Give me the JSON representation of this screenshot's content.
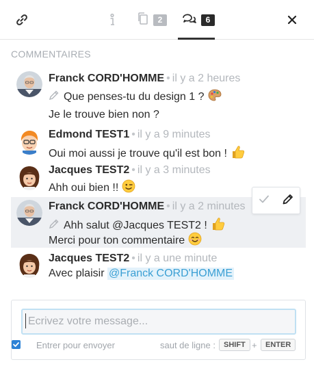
{
  "toolbar": {
    "files_count": "2",
    "comments_count": "6",
    "active_tab": "comments"
  },
  "section_title": "COMMENTAIRES",
  "comments": [
    {
      "author": "Franck CORD'HOMME",
      "time": "il y a 2 heures",
      "lines": [
        "Que penses-tu du design 1 ?",
        "Je le trouve bien non ?"
      ],
      "edited": true,
      "avatar": "franck-avatar",
      "emoji": "palette-icon"
    },
    {
      "author": "Edmond TEST1",
      "time": "il y a 9 minutes",
      "lines": [
        "Oui moi aussi je trouve qu'il est bon !"
      ],
      "avatar": "edmond-avatar",
      "emoji": "thumbs-up-icon"
    },
    {
      "author": "Jacques TEST2",
      "time": "il y a 3 minutes",
      "lines": [
        "Ahh oui bien !!"
      ],
      "avatar": "jacques-avatar",
      "emoji": "winking-face-icon"
    },
    {
      "author": "Franck CORD'HOMME",
      "time": "il y a 2 minutes",
      "lines": [
        "Ahh salut @Jacques TEST2 !",
        "Merci pour ton commentaire"
      ],
      "edited": true,
      "highlighted": true,
      "avatar": "franck-avatar",
      "emoji": [
        "thumbs-up-icon",
        "smiling-face-icon"
      ]
    },
    {
      "author": "Jacques TEST2",
      "time": "il y a une minute",
      "text": "Avec plaisir",
      "mention": "@Franck CORD'HOMME",
      "avatar": "jacques-avatar"
    }
  ],
  "composer": {
    "placeholder": "Ecrivez votre message...",
    "send_on_enter_label": "Entrer pour envoyer",
    "send_on_enter_checked": true,
    "line_break_label": "saut de ligne :",
    "key_shift": "SHIFT",
    "plus": "+",
    "key_enter": "ENTER"
  },
  "colors": {
    "accent": "#2c82d6",
    "mention_text": "#3a9fd4",
    "mention_bg": "#e3f2fb",
    "highlight_bg": "#eef0f3"
  }
}
